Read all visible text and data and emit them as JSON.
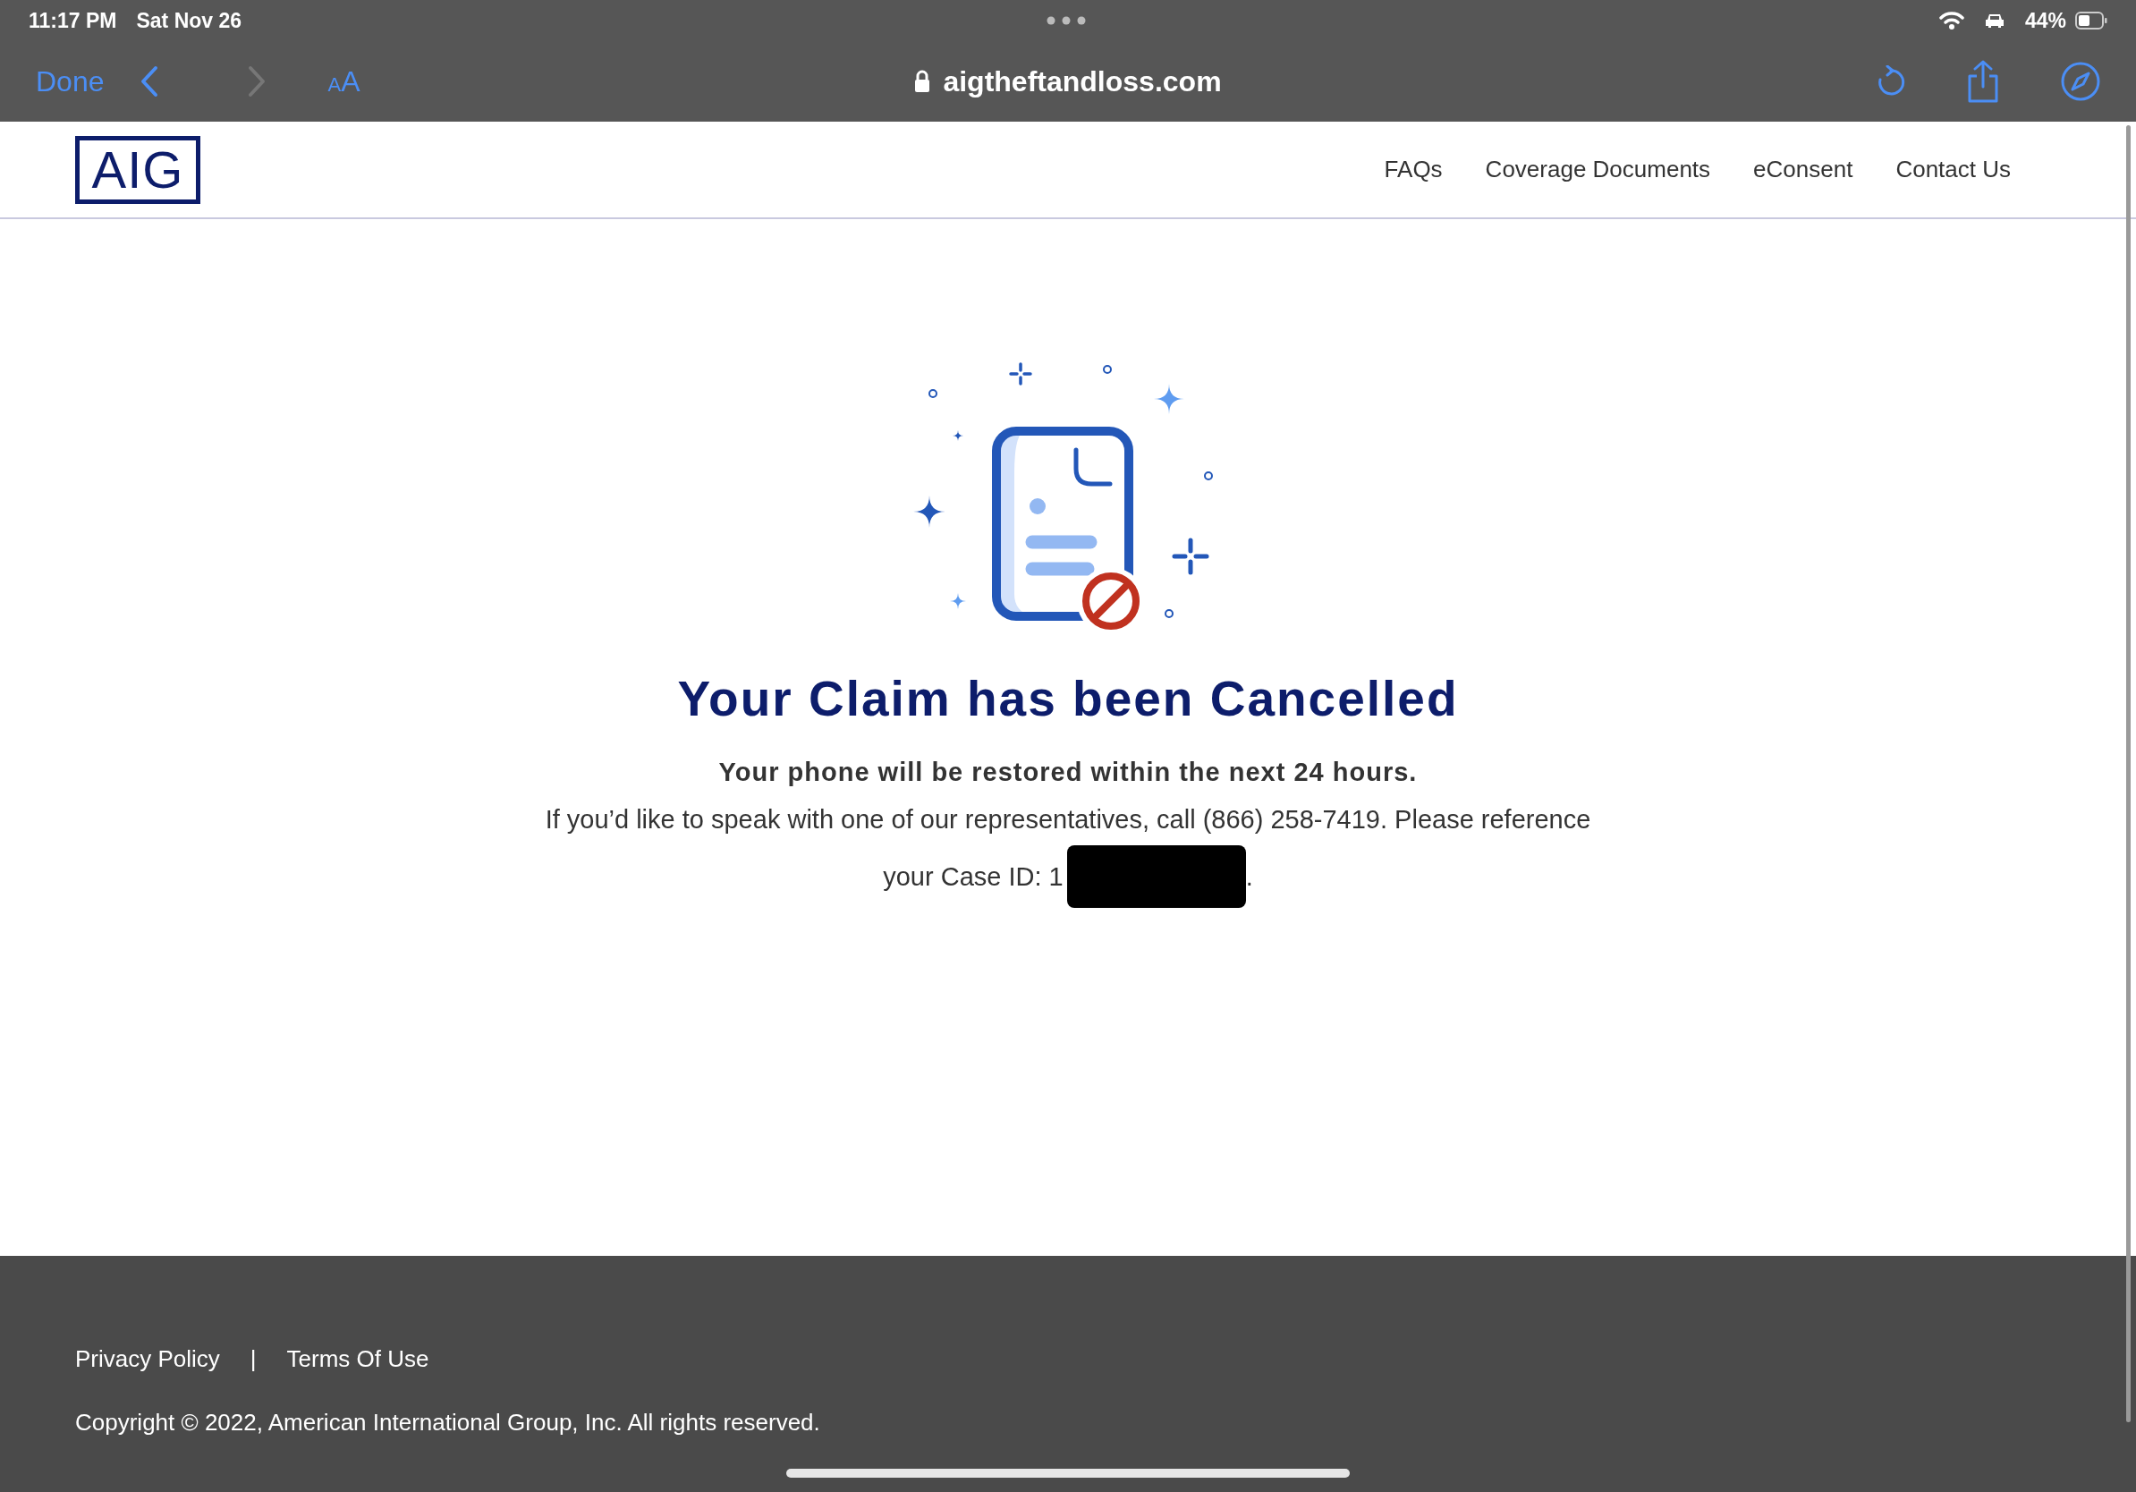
{
  "status_bar": {
    "time": "11:17 PM",
    "date": "Sat Nov 26",
    "battery": "44%"
  },
  "browser_toolbar": {
    "done": "Done",
    "back": {
      "disabled": false
    },
    "forward": {
      "disabled": true
    },
    "text_size": "AA",
    "url": "aigtheftandloss.com"
  },
  "site_header": {
    "logo": "AIG",
    "nav": [
      {
        "label": "FAQs"
      },
      {
        "label": "Coverage Documents"
      },
      {
        "label": "eConsent"
      },
      {
        "label": "Contact Us"
      }
    ]
  },
  "content": {
    "title": "Your Claim has been Cancelled",
    "subtitle": "Your phone will be restored within the next 24 hours.",
    "message": "If you’d like to speak with one of our representatives, call (866) 258-7419. Please reference",
    "case_id_label": "your Case ID: 1",
    "case_id_redacted": true,
    "case_id_end": "."
  },
  "footer": {
    "links": [
      {
        "label": "Privacy Policy"
      },
      {
        "label": "Terms Of Use"
      }
    ],
    "separator": "|",
    "copyright": "Copyright © 2022, American International Group, Inc. All rights reserved."
  }
}
